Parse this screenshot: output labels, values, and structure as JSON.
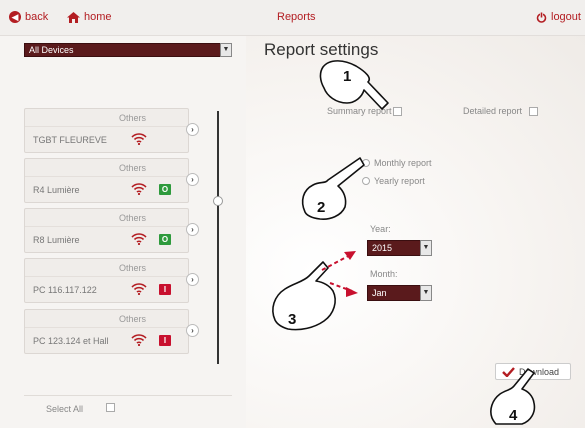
{
  "topbar": {
    "back_label": "back",
    "home_label": "home",
    "title": "Reports",
    "logout_label": "logout"
  },
  "device_filter": {
    "selected": "All Devices"
  },
  "devices": [
    {
      "category": "Others",
      "name": "TGBT FLEUREVE",
      "status": ""
    },
    {
      "category": "Others",
      "name": "R4 Lumière",
      "status": "O"
    },
    {
      "category": "Others",
      "name": "R8 Lumière",
      "status": "O"
    },
    {
      "category": "Others",
      "name": "PC 116.117.122",
      "status": "I"
    },
    {
      "category": "Others",
      "name": "PC 123.124 et Hall",
      "status": "I"
    }
  ],
  "select_all_label": "Select All",
  "settings": {
    "title": "Report settings",
    "summary_label": "Summary report",
    "detailed_label": "Detailed report",
    "monthly_label": "Monthly report",
    "yearly_label": "Yearly report",
    "year_label": "Year:",
    "year_value": "2015",
    "month_label": "Month:",
    "month_value": "Jan",
    "download_label": "Download"
  },
  "annotations": [
    "1",
    "2",
    "3",
    "4"
  ],
  "colors": {
    "accent": "#b31d22",
    "dark_select": "#5a1a1c",
    "status_on": "#2e9a3c",
    "status_off": "#c8102e"
  }
}
